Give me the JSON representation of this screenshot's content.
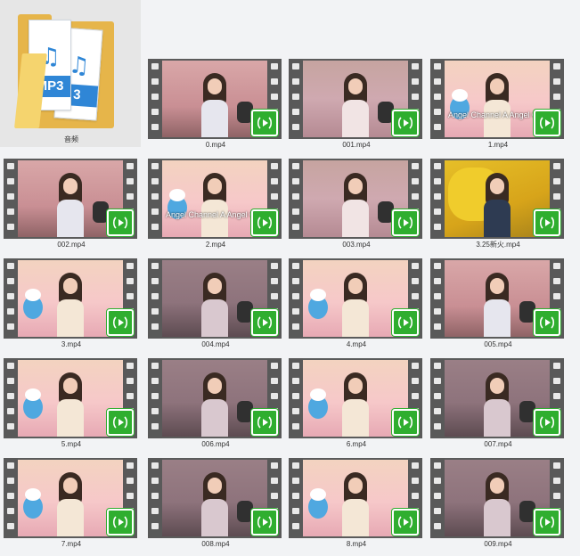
{
  "folder": {
    "name": "音频",
    "doc_front_label": "MP3",
    "doc_back_label": "3",
    "icon": "audio-folder-icon",
    "colors": {
      "folder": "#e6b54a",
      "doc_accent": "#2f86d6"
    }
  },
  "files": [
    {
      "name": "0.mp4",
      "scene": "pink",
      "overlay": ""
    },
    {
      "name": "001.mp4",
      "scene": "bed",
      "overlay": ""
    },
    {
      "name": "1.mp4",
      "scene": "light",
      "overlay": "Angel Channel A Angel C"
    },
    {
      "name": "002.mp4",
      "scene": "pink",
      "overlay": ""
    },
    {
      "name": "2.mp4",
      "scene": "light",
      "overlay": "Angel Channel A Angel C"
    },
    {
      "name": "003.mp4",
      "scene": "bed",
      "overlay": ""
    },
    {
      "name": "3.25新火.mp4",
      "scene": "yellow",
      "overlay": ""
    },
    {
      "name": "3.mp4",
      "scene": "light",
      "overlay": ""
    },
    {
      "name": "004.mp4",
      "scene": "dim",
      "overlay": ""
    },
    {
      "name": "4.mp4",
      "scene": "light",
      "overlay": ""
    },
    {
      "name": "005.mp4",
      "scene": "pink",
      "overlay": ""
    },
    {
      "name": "5.mp4",
      "scene": "light",
      "overlay": ""
    },
    {
      "name": "006.mp4",
      "scene": "dim",
      "overlay": ""
    },
    {
      "name": "6.mp4",
      "scene": "light",
      "overlay": ""
    },
    {
      "name": "007.mp4",
      "scene": "dim",
      "overlay": ""
    },
    {
      "name": "7.mp4",
      "scene": "light",
      "overlay": ""
    },
    {
      "name": "008.mp4",
      "scene": "dim",
      "overlay": ""
    },
    {
      "name": "8.mp4",
      "scene": "light",
      "overlay": ""
    },
    {
      "name": "009.mp4",
      "scene": "dim",
      "overlay": ""
    }
  ],
  "badge_icon": "iqiyi-play-badge-icon",
  "colors": {
    "badge": "#2fae2f",
    "film_strip": "#595959",
    "background": "#f2f3f5"
  }
}
